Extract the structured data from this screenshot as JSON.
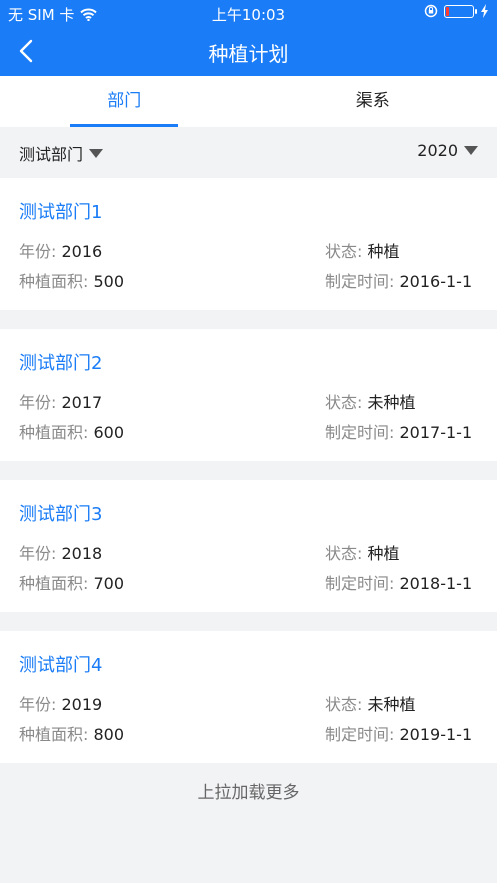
{
  "status_bar": {
    "carrier": "无 SIM 卡",
    "time": "上午10:03"
  },
  "nav": {
    "title": "种植计划"
  },
  "tabs": [
    {
      "label": "部门",
      "active": true
    },
    {
      "label": "渠系",
      "active": false
    }
  ],
  "filters": {
    "department": "测试部门",
    "year": "2020"
  },
  "labels": {
    "year": "年份:",
    "area": "种植面积:",
    "status": "状态:",
    "date": "制定时间:"
  },
  "items": [
    {
      "name": "测试部门1",
      "year": "2016",
      "area": "500",
      "status": "种植",
      "date": "2016-1-1"
    },
    {
      "name": "测试部门2",
      "year": "2017",
      "area": "600",
      "status": "未种植",
      "date": "2017-1-1"
    },
    {
      "name": "测试部门3",
      "year": "2018",
      "area": "700",
      "status": "种植",
      "date": "2018-1-1"
    },
    {
      "name": "测试部门4",
      "year": "2019",
      "area": "800",
      "status": "未种植",
      "date": "2019-1-1"
    }
  ],
  "load_more": "上拉加载更多",
  "colors": {
    "primary": "#1a7cf6",
    "background": "#f2f3f5",
    "battery_low": "#ff3b30"
  }
}
